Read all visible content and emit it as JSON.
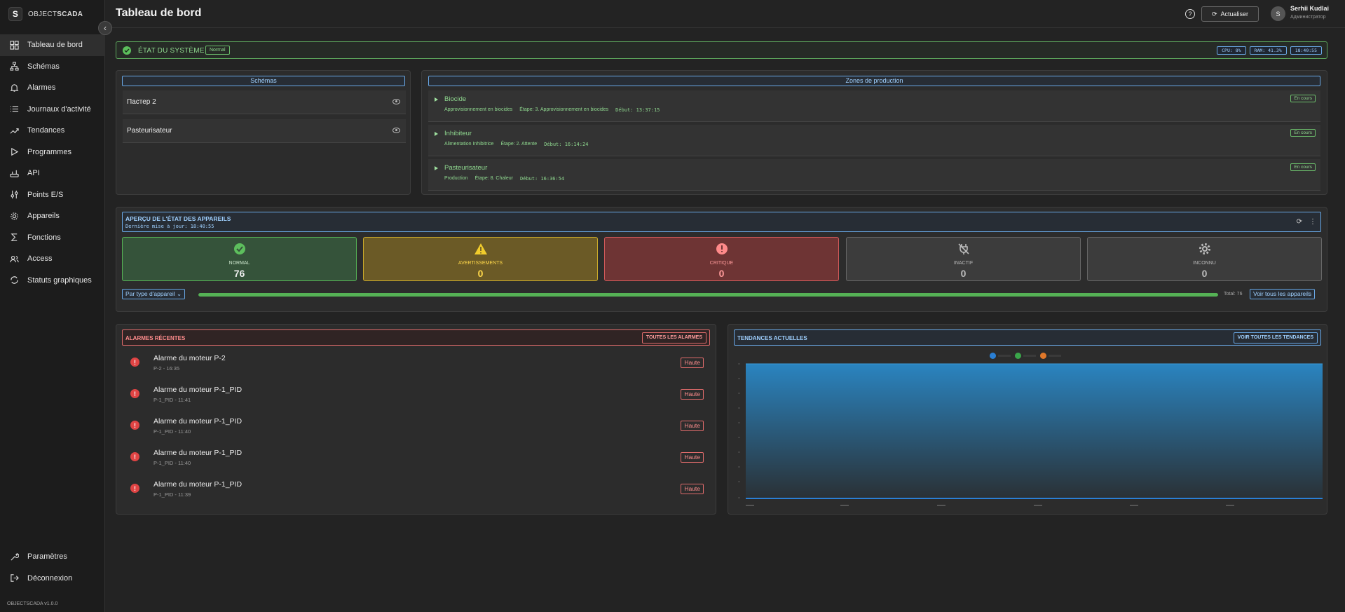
{
  "brand": {
    "logo_letter": "S",
    "name_light": "OBJECT",
    "name_bold": "SCADA",
    "version": "OBJECTSCADA v1.0.0"
  },
  "sidebar": {
    "items": [
      {
        "label": "Tableau de bord",
        "icon": "dashboard-icon"
      },
      {
        "label": "Schémas",
        "icon": "schema-icon"
      },
      {
        "label": "Alarmes",
        "icon": "bell-icon"
      },
      {
        "label": "Journaux d'activité",
        "icon": "list-icon"
      },
      {
        "label": "Tendances",
        "icon": "trend-icon"
      },
      {
        "label": "Programmes",
        "icon": "play-icon"
      },
      {
        "label": "API",
        "icon": "router-icon"
      },
      {
        "label": "Points E/S",
        "icon": "io-icon"
      },
      {
        "label": "Appareils",
        "icon": "device-gear-icon"
      },
      {
        "label": "Fonctions",
        "icon": "sigma-icon"
      },
      {
        "label": "Access",
        "icon": "users-icon"
      },
      {
        "label": "Statuts graphiques",
        "icon": "cycle-icon"
      }
    ],
    "bottom": [
      {
        "label": "Paramètres",
        "icon": "wrench-icon"
      },
      {
        "label": "Déconnexion",
        "icon": "logout-icon"
      }
    ]
  },
  "header": {
    "title": "Tableau de bord",
    "refresh_label": "Actualiser",
    "user_initial": "S",
    "user_name": "Serhii Kudlai",
    "user_role": "Администратор"
  },
  "system": {
    "title": "ÉTAT DU SYSTÈME",
    "status": "Normal",
    "cpu": "CPU: 8%",
    "ram": "RAM: 41.3%",
    "time": "18:40:55"
  },
  "schemas": {
    "title": "Schémas",
    "items": [
      "Пастер 2",
      "Pasteurisateur"
    ]
  },
  "zones": {
    "title": "Zones de production",
    "items": [
      {
        "name": "Biocide",
        "process": "Approvisionnement en biocides",
        "step": "Étape: 3. Approvisionnement en biocides",
        "start": "Début: 13:37:15",
        "status": "En cours"
      },
      {
        "name": "Inhibiteur",
        "process": "Alimentation Inhibitrice",
        "step": "Étape: 2. Attente",
        "start": "Début: 16:14:24",
        "status": "En cours"
      },
      {
        "name": "Pasteurisateur",
        "process": "Production",
        "step": "Étape: 8. Chaleur",
        "start": "Début: 16:36:54",
        "status": "En cours"
      }
    ]
  },
  "devices": {
    "title": "APERÇU DE L'ÉTAT DES APPAREILS",
    "updated": "Dernière mise à jour: 18:40:55",
    "stats": [
      {
        "label": "NORMAL",
        "value": "76",
        "color": "#55b255"
      },
      {
        "label": "AVERTISSEMENTS",
        "value": "0",
        "color": "#e6c22c"
      },
      {
        "label": "CRITIQUE",
        "value": "0",
        "color": "#ff6b6b"
      },
      {
        "label": "INACTIF",
        "value": "0",
        "color": "#9a9a9a"
      },
      {
        "label": "INCONNU",
        "value": "0",
        "color": "#9a9a9a"
      }
    ],
    "filter": "Par type d'appareil",
    "total": "Total: 76",
    "view_all": "Voir tous les appareils",
    "normal_fraction": 1.0
  },
  "alarms": {
    "title": "ALARMES RÉCENTES",
    "all_label": "TOUTES LES ALARMES",
    "items": [
      {
        "name": "Alarme du moteur P-2",
        "sub": "P-2 - 16:35",
        "priority": "Haute"
      },
      {
        "name": "Alarme du moteur P-1_PID",
        "sub": "P-1_PID - 11:41",
        "priority": "Haute"
      },
      {
        "name": "Alarme du moteur P-1_PID",
        "sub": "P-1_PID - 11:40",
        "priority": "Haute"
      },
      {
        "name": "Alarme du moteur P-1_PID",
        "sub": "P-1_PID - 11:40",
        "priority": "Haute"
      },
      {
        "name": "Alarme du moteur P-1_PID",
        "sub": "P-1_PID - 11:39",
        "priority": "Haute"
      }
    ]
  },
  "trends": {
    "title": "TENDANCES ACTUELLES",
    "all_label": "VOIR TOUTES LES TENDANCES",
    "legend_colors": [
      "#2a7fd4",
      "#3aa64a",
      "#e0782a"
    ]
  }
}
